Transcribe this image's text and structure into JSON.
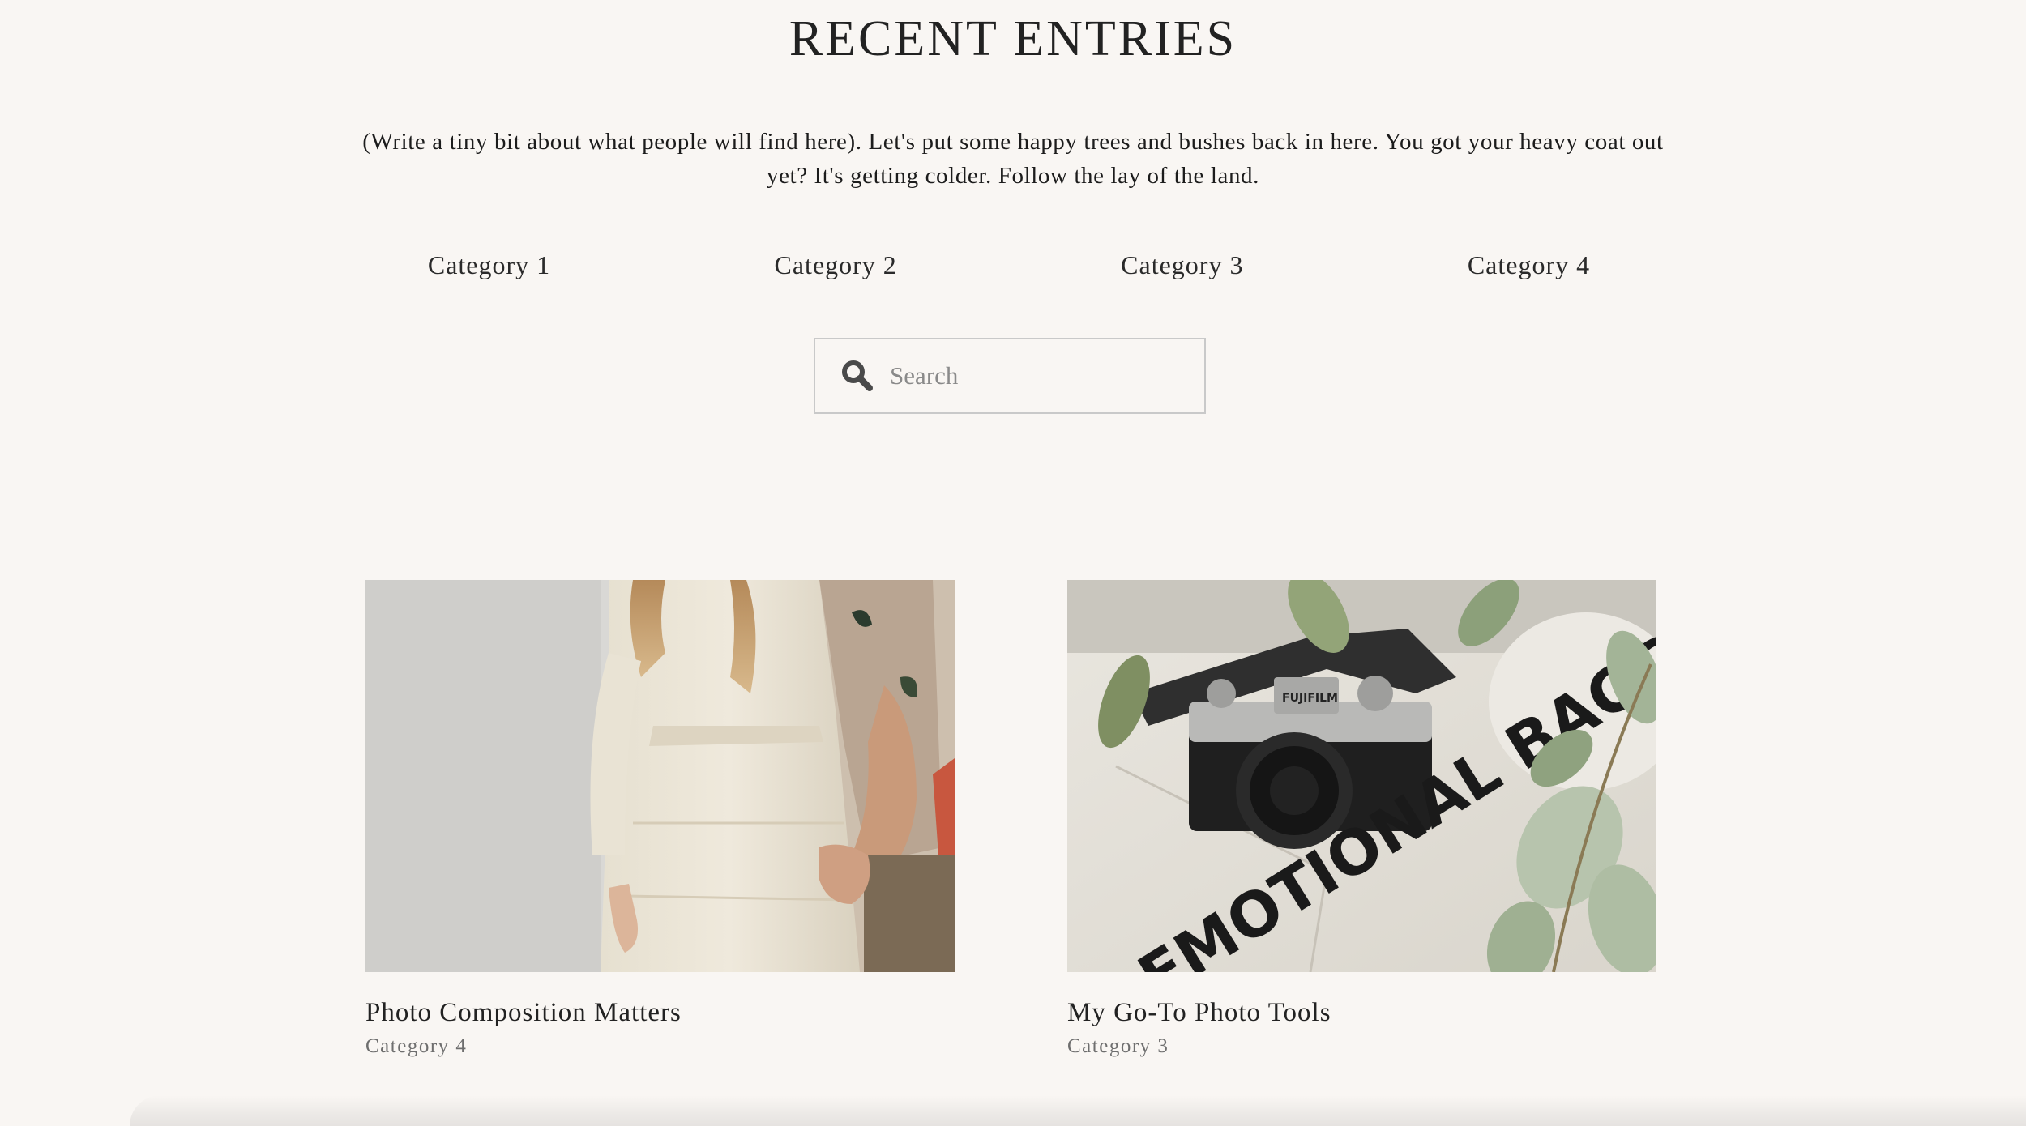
{
  "header": {
    "title": "RECENT ENTRIES",
    "intro": "(Write a tiny bit about what people will find here). Let's put some happy trees and bushes back in here. You got your heavy coat out yet? It's getting colder. Follow the lay of the land."
  },
  "categories": [
    {
      "label": "Category 1"
    },
    {
      "label": "Category 2"
    },
    {
      "label": "Category 3"
    },
    {
      "label": "Category 4"
    }
  ],
  "search": {
    "placeholder": "Search",
    "value": "",
    "icon": "search-icon"
  },
  "posts": [
    {
      "title": "Photo Composition Matters",
      "category": "Category 4",
      "image_subject": "couple-holding-hands-photo"
    },
    {
      "title": "My Go-To Photo Tools",
      "category": "Category 3",
      "image_subject": "fujifilm-camera-on-tote-bag-photo",
      "image_text_fujifilm": "FUJIFILM",
      "image_text_bag": "EMOTIONAL BAGG"
    }
  ],
  "colors": {
    "background": "#f9f6f3",
    "text": "#1f1f1f",
    "muted": "#6e6e6e",
    "border": "#c9c9c9"
  }
}
